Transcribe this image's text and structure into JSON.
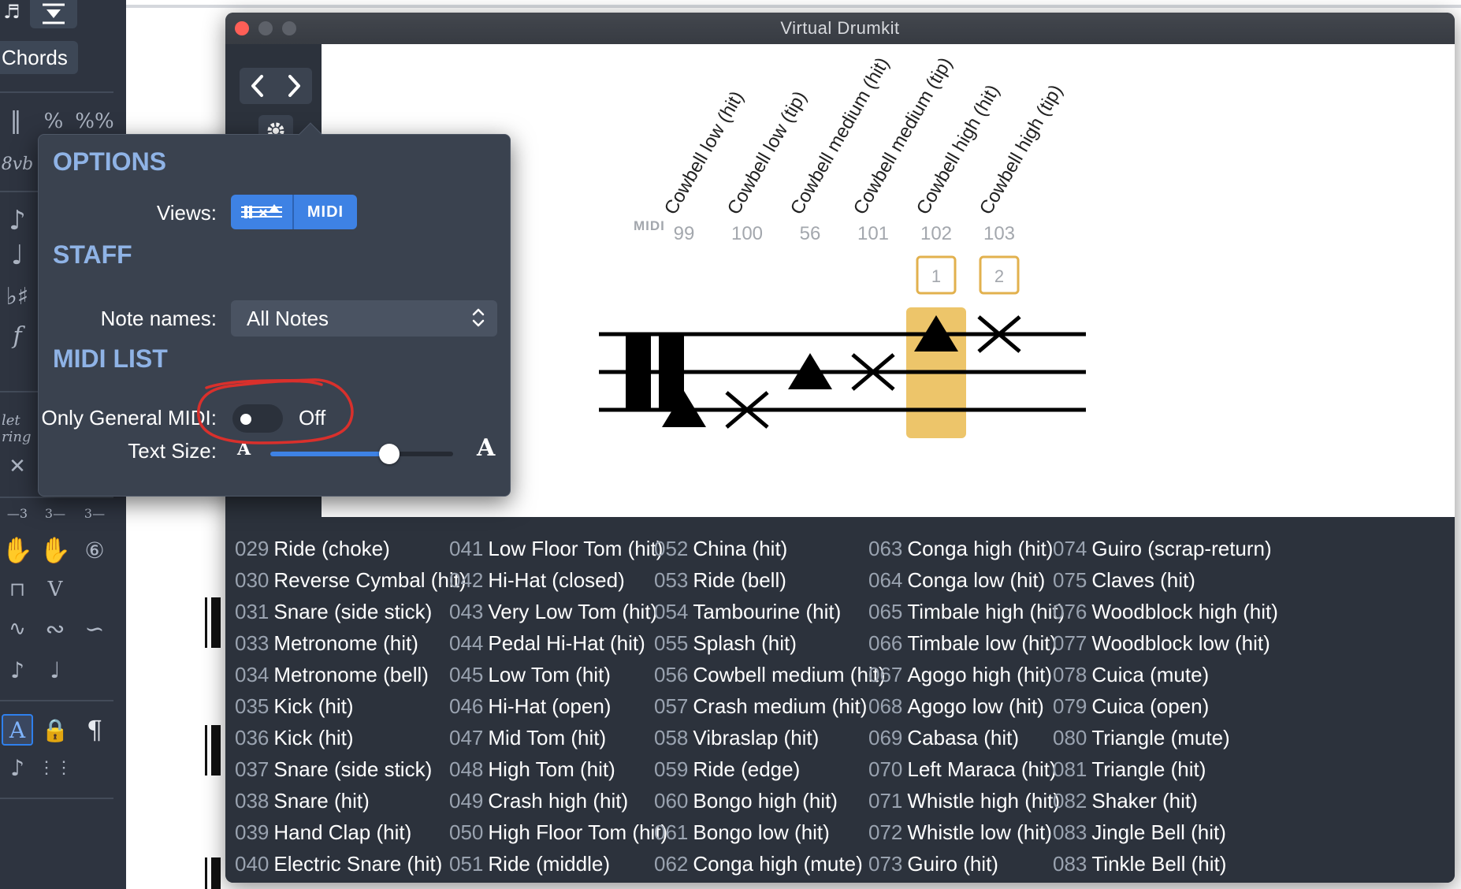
{
  "window": {
    "title": "Virtual Drumkit",
    "nav_prev": "‹",
    "nav_next": "›"
  },
  "palette": {
    "chords_label": "Chords"
  },
  "options": {
    "heading": "OPTIONS",
    "views_label": "Views:",
    "views": [
      "Staff view",
      "MIDI view"
    ],
    "views_midi_text": "MIDI",
    "staff_heading": "STAFF",
    "note_names_label": "Note names:",
    "note_names_value": "All Notes",
    "midi_list_heading": "MIDI LIST",
    "only_gm_label": "Only General MIDI:",
    "only_gm_state": "Off",
    "text_size_label": "Text Size:",
    "text_size_small": "A",
    "text_size_large": "A",
    "text_size_value": 0.65
  },
  "notation": {
    "midi_badge": "MIDI",
    "highlight_color": "#edc56a",
    "box_color": "#e2b14e",
    "instruments": [
      {
        "name": "Cowbell low (hit)",
        "midi": "99",
        "head": "triangle",
        "line": 2,
        "key": ""
      },
      {
        "name": "Cowbell low (tip)",
        "midi": "100",
        "head": "x",
        "line": 2,
        "key": ""
      },
      {
        "name": "Cowbell medium (hit)",
        "midi": "56",
        "head": "triangle",
        "line": 1,
        "key": ""
      },
      {
        "name": "Cowbell medium (tip)",
        "midi": "101",
        "head": "x",
        "line": 1,
        "key": ""
      },
      {
        "name": "Cowbell high (hit)",
        "midi": "102",
        "head": "triangle",
        "line": 0,
        "key": "1",
        "highlight": true
      },
      {
        "name": "Cowbell high (tip)",
        "midi": "103",
        "head": "x",
        "line": 0,
        "key": "2"
      }
    ]
  },
  "midi_list": {
    "columns": [
      [
        [
          "029",
          "Ride (choke)"
        ],
        [
          "030",
          "Reverse Cymbal (hit)"
        ],
        [
          "031",
          "Snare (side stick)"
        ],
        [
          "033",
          "Metronome (hit)"
        ],
        [
          "034",
          "Metronome (bell)"
        ],
        [
          "035",
          "Kick (hit)"
        ],
        [
          "036",
          "Kick (hit)"
        ],
        [
          "037",
          "Snare (side stick)"
        ],
        [
          "038",
          "Snare (hit)"
        ],
        [
          "039",
          "Hand Clap (hit)"
        ],
        [
          "040",
          "Electric Snare (hit)"
        ]
      ],
      [
        [
          "041",
          "Low Floor Tom (hit)"
        ],
        [
          "042",
          "Hi-Hat (closed)"
        ],
        [
          "043",
          "Very Low Tom (hit)"
        ],
        [
          "044",
          "Pedal Hi-Hat (hit)"
        ],
        [
          "045",
          "Low Tom (hit)"
        ],
        [
          "046",
          "Hi-Hat (open)"
        ],
        [
          "047",
          "Mid Tom (hit)"
        ],
        [
          "048",
          "High Tom (hit)"
        ],
        [
          "049",
          "Crash high (hit)"
        ],
        [
          "050",
          "High Floor Tom (hit)"
        ],
        [
          "051",
          "Ride (middle)"
        ]
      ],
      [
        [
          "052",
          "China (hit)"
        ],
        [
          "053",
          "Ride (bell)"
        ],
        [
          "054",
          "Tambourine (hit)"
        ],
        [
          "055",
          "Splash (hit)"
        ],
        [
          "056",
          "Cowbell medium (hit)"
        ],
        [
          "057",
          "Crash medium (hit)"
        ],
        [
          "058",
          "Vibraslap (hit)"
        ],
        [
          "059",
          "Ride (edge)"
        ],
        [
          "060",
          "Bongo high (hit)"
        ],
        [
          "061",
          "Bongo low (hit)"
        ],
        [
          "062",
          "Conga high (mute)"
        ]
      ],
      [
        [
          "063",
          "Conga high (hit)"
        ],
        [
          "064",
          "Conga low (hit)"
        ],
        [
          "065",
          "Timbale high (hit)"
        ],
        [
          "066",
          "Timbale low (hit)"
        ],
        [
          "067",
          "Agogo high (hit)"
        ],
        [
          "068",
          "Agogo low (hit)"
        ],
        [
          "069",
          "Cabasa (hit)"
        ],
        [
          "070",
          "Left Maraca (hit)"
        ],
        [
          "071",
          "Whistle high (hit)"
        ],
        [
          "072",
          "Whistle low (hit)"
        ],
        [
          "073",
          "Guiro (hit)"
        ]
      ],
      [
        [
          "074",
          "Guiro (scrap-return)"
        ],
        [
          "075",
          "Claves (hit)"
        ],
        [
          "076",
          "Woodblock high (hit)"
        ],
        [
          "077",
          "Woodblock low (hit)"
        ],
        [
          "078",
          "Cuica (mute)"
        ],
        [
          "079",
          "Cuica (open)"
        ],
        [
          "080",
          "Triangle (mute)"
        ],
        [
          "081",
          "Triangle (hit)"
        ],
        [
          "082",
          "Shaker (hit)"
        ],
        [
          "083",
          "Jingle Bell (hit)"
        ],
        [
          "083",
          "Tinkle Bell (hit)"
        ]
      ]
    ]
  },
  "annotation": {
    "color": "#d9302c"
  },
  "colors": {
    "accent": "#3e82e4",
    "panel": "#3a424f",
    "window_bg": "#2c323c",
    "heading": "#8fb3e6"
  }
}
